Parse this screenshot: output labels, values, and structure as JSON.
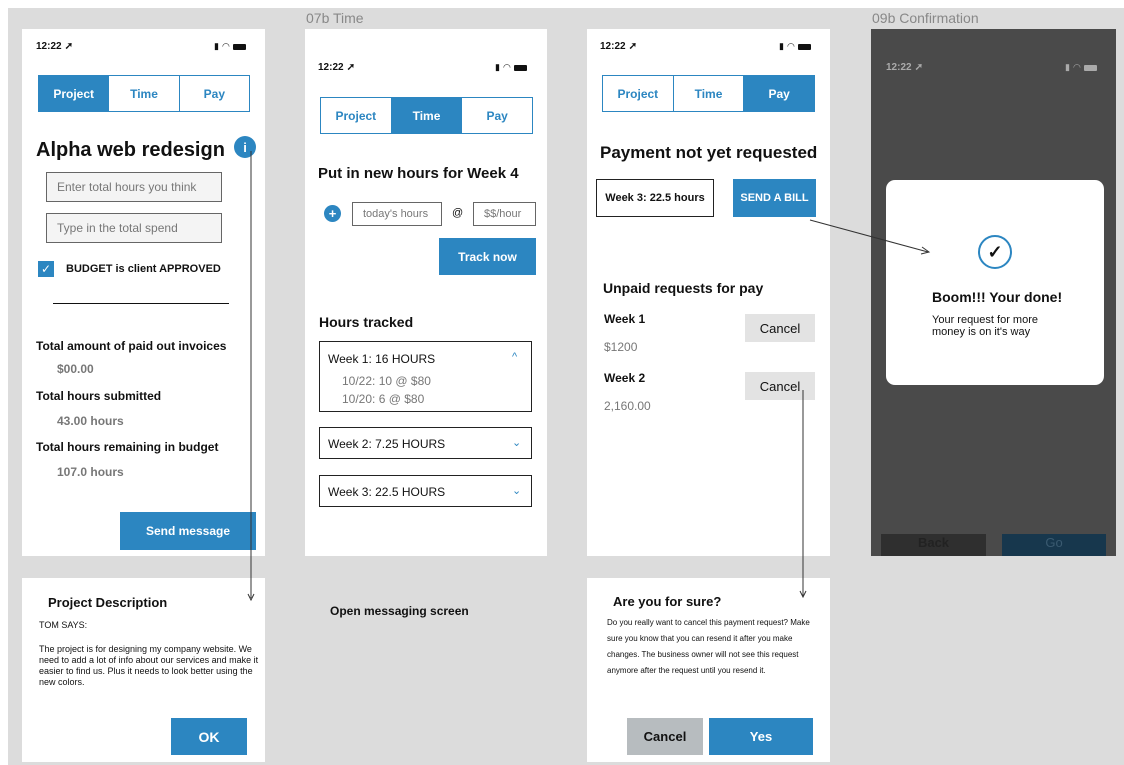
{
  "labels": {
    "time": "07b Time",
    "confirm": "09b Confirmation"
  },
  "status": {
    "time": "12:22"
  },
  "tabs": {
    "project": "Project",
    "time": "Time",
    "pay": "Pay"
  },
  "project": {
    "title": "Alpha web redesign",
    "info_icon": "i",
    "hours_placeholder": "Enter total hours you think",
    "spend_placeholder": "Type in the total spend",
    "budget_label": "BUDGET is client APPROVED",
    "paid_label": "Total amount of paid out invoices",
    "paid_value": "$00.00",
    "submitted_label": "Total hours submitted",
    "submitted_value": "43.00 hours",
    "remaining_label": "Total hours remaining in budget",
    "remaining_value": "107.0 hours",
    "send_button": "Send message"
  },
  "time": {
    "heading": "Put in new hours for Week 4",
    "hours_placeholder": "today's hours",
    "at": "@",
    "rate_placeholder": "$$/hour",
    "track_button": "Track now",
    "tracked_heading": "Hours tracked",
    "weeks": [
      {
        "label": "Week 1: 16 HOURS",
        "entries": [
          "10/22: 10 @ $80",
          "10/20: 6 @ $80"
        ]
      },
      {
        "label": "Week 2: 7.25 HOURS"
      },
      {
        "label": "Week 3: 22.5 HOURS"
      }
    ]
  },
  "pay": {
    "heading": "Payment not yet requested",
    "week_box": "Week 3: 22.5 hours",
    "bill_button": "SEND A BILL",
    "unpaid_heading": "Unpaid requests for pay",
    "requests": [
      {
        "week": "Week 1",
        "amount": "$1200",
        "cancel": "Cancel"
      },
      {
        "week": "Week 2",
        "amount": "2,160.00",
        "cancel": "Cancel"
      }
    ]
  },
  "confirm": {
    "title": "Boom!!! Your done!",
    "message": "Your request for more money is on it's way",
    "back": "Back",
    "go": "Go"
  },
  "description": {
    "title": "Project Description",
    "author": "TOM SAYS:",
    "body": "The project is for designing my company website. We need to add a lot of info about our services and make it easier to find us. Plus it needs to look better using the new colors.",
    "ok": "OK"
  },
  "messaging": {
    "label": "Open messaging screen"
  },
  "cancel_dialog": {
    "title": "Are you for sure?",
    "body": "Do you really want to cancel this payment request? Make sure you know that you can resend it after you make changes. The business owner will not see this request anymore after the request until you resend it.",
    "cancel": "Cancel",
    "yes": "Yes"
  },
  "colors": {
    "accent": "#2c86c1",
    "dark_overlay": "#4a4a4a"
  }
}
